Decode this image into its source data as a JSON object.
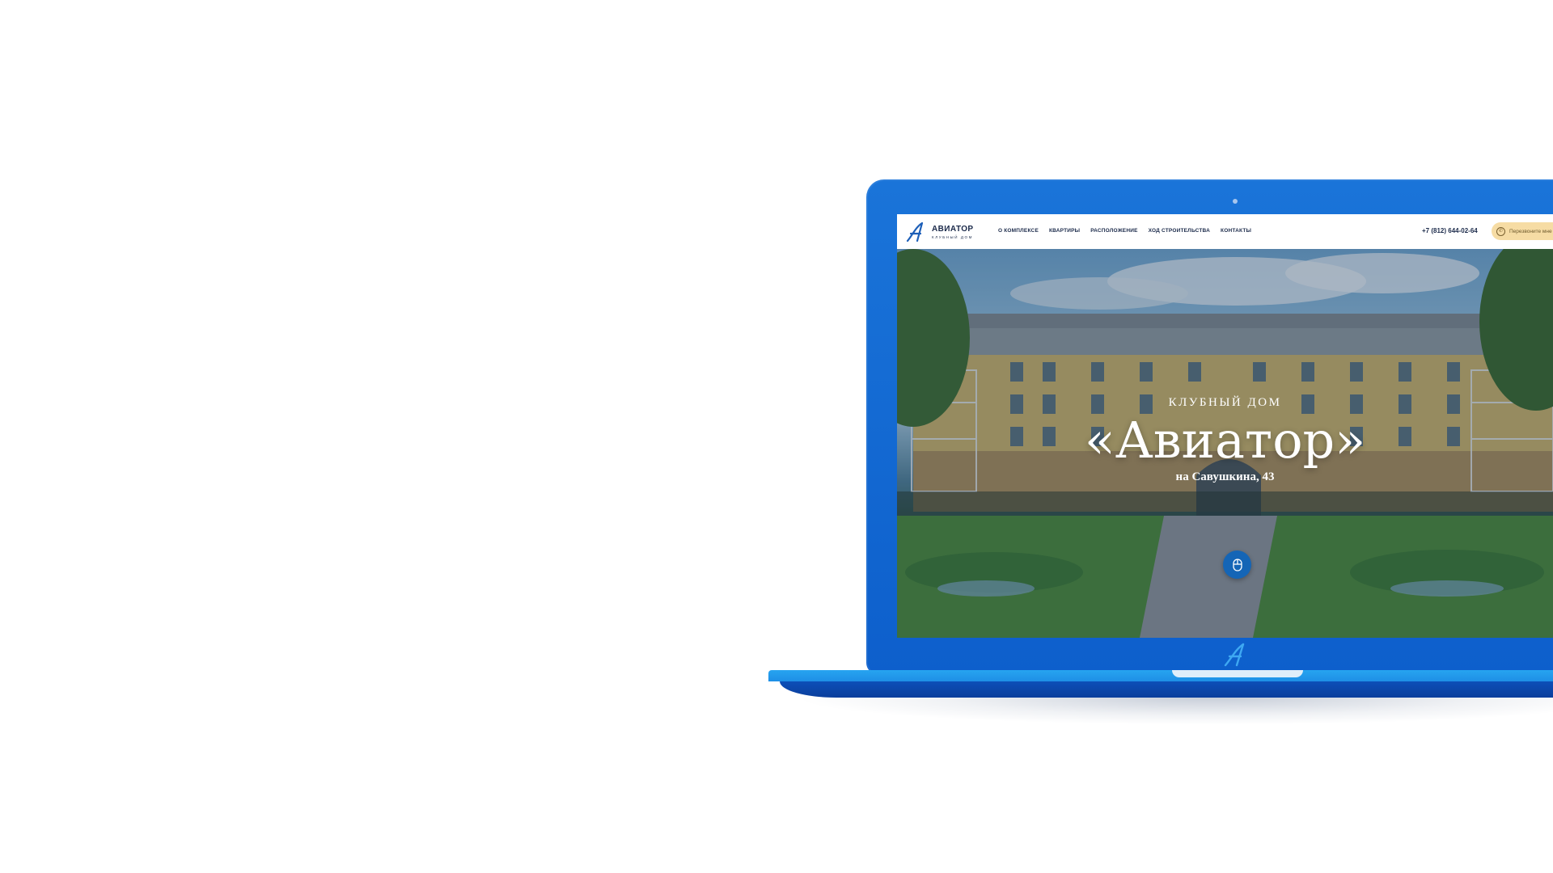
{
  "site": {
    "logo": {
      "word": "АВИАТОР",
      "sub": "КЛУБНЫЙ ДОМ"
    },
    "nav": [
      {
        "label": "О КОМПЛЕКСЕ"
      },
      {
        "label": "КВАРТИРЫ"
      },
      {
        "label": "РАСПОЛОЖЕНИЕ"
      },
      {
        "label": "ХОД СТРОИТЕЛЬСТВА"
      },
      {
        "label": "КОНТАКТЫ"
      }
    ],
    "phone": "+7 (812) 644-02-64",
    "callback": {
      "label": "Перезвоните мне",
      "icon": "phone-icon"
    }
  },
  "hero": {
    "kicker": "КЛУБНЫЙ ДОМ",
    "title": "«Авиатор»",
    "address": "на Савушкина, 43",
    "scroll_icon": "mouse-icon"
  },
  "colors": {
    "lid": "#0d5fcc",
    "base_light": "#27a4f0",
    "base_dark": "#0a3e9c",
    "accent_button": "#1465b6",
    "callback_bg": "#f6dca4"
  }
}
